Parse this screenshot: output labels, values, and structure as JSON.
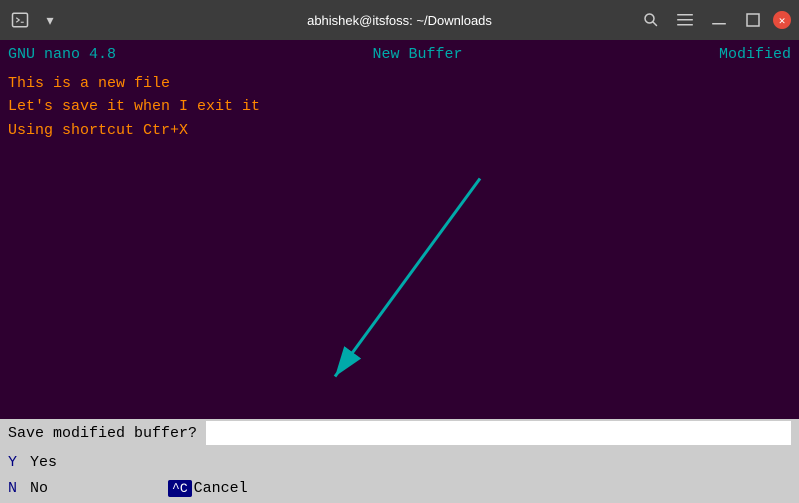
{
  "titlebar": {
    "title": "abhishek@itsfoss: ~/Downloads",
    "search_icon": "🔍",
    "menu_icon": "≡",
    "minimize_icon": "—",
    "maximize_icon": "□"
  },
  "nano": {
    "version": "GNU nano 4.8",
    "buffer_title": "New Buffer",
    "status": "Modified",
    "content_lines": [
      "This is a new file",
      "Let's save it when I exit it",
      "Using shortcut Ctr+X"
    ],
    "statusbar_prompt": "Save modified buffer?",
    "options": [
      {
        "key": "Y",
        "label": "Yes"
      },
      {
        "key": "N",
        "label": "No"
      }
    ],
    "cancel_shortcut": "^C",
    "cancel_label": "Cancel"
  }
}
